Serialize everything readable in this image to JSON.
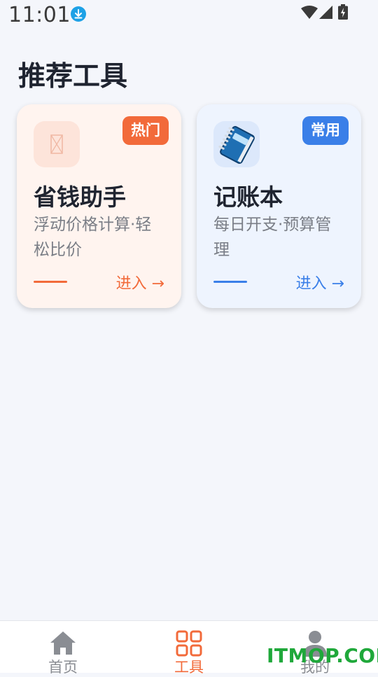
{
  "status_bar": {
    "time": "11:01"
  },
  "page": {
    "title": "推荐工具"
  },
  "cards": [
    {
      "badge": "热门",
      "title": "省钱助手",
      "description": "浮动价格计算·轻松比价",
      "enter": "进入 →",
      "accent": "#f26a3a",
      "icon": "placeholder-image-icon"
    },
    {
      "badge": "常用",
      "title": "记账本",
      "description": "每日开支·预算管理",
      "enter": "进入 →",
      "accent": "#3a7fe8",
      "icon": "notebook-icon"
    }
  ],
  "tab_bar": {
    "tabs": [
      {
        "label": "首页",
        "icon": "home-icon",
        "active": false
      },
      {
        "label": "工具",
        "icon": "grid-icon",
        "active": true
      },
      {
        "label": "我的",
        "icon": "user-icon",
        "active": false
      }
    ],
    "active_color": "#f26a3a"
  },
  "watermark": {
    "text": "ITMOP.COM"
  }
}
